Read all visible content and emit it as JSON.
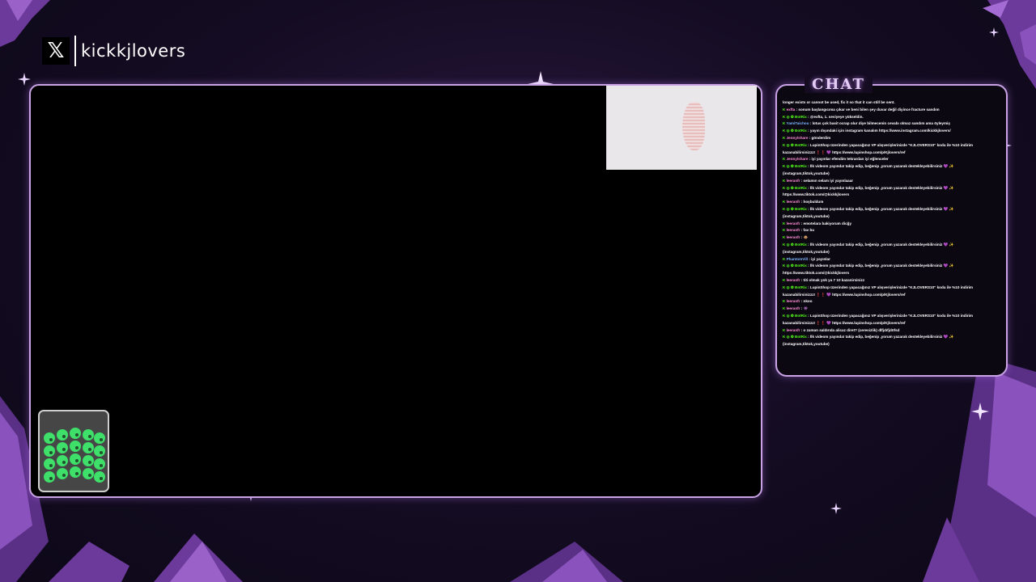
{
  "brand": {
    "logo_icon": "x-logo-icon",
    "channel": "kickkjlovers"
  },
  "chat": {
    "title": "CHAT",
    "messages": [
      {
        "badges": "",
        "user": "",
        "user_color": "",
        "text": "longer exists or cannot be used, fix it so that it can still be sent."
      },
      {
        "badges": "K",
        "user": "exfta",
        "user_color": "pink",
        "text": ": sonum başlangıcıma çıkar ve beni bilen şey duvar değil diyince fracture sandım"
      },
      {
        "badges": "K ◎ ❂",
        "user": "BotRix",
        "user_color": "green",
        "text": ": @exfta, 1. seviyeye yükseldin."
      },
      {
        "badges": "K",
        "user": "YamiTaichou",
        "user_color": "blue",
        "text": ": lotus çok basit ocrap olur diye bilmecenin cevabı olmaz sandım ama öyleymiş"
      },
      {
        "badges": "K ◎ ❂",
        "user": "BotRix",
        "user_color": "green",
        "text": ": yayın dışındaki için instagram kanalım https://www.instagram.com/kickkjlovers/"
      },
      {
        "badges": "K",
        "user": "Jenny/share",
        "user_color": "pink",
        "text": ": gönderdim"
      },
      {
        "badges": "K ◎ ❂",
        "user": "BotRix",
        "user_color": "green",
        "text": ": LupinShop üzerinden yapacağınız VP alışverişlerinizde \"KJLOVERS10\" kodu ile %10 indirim kazanabilirsinizzz! ❗❗ 💜 https://www.lupinshop.com/p/Kjlovers/ref"
      },
      {
        "badges": "K",
        "user": "Jenny/share",
        "user_color": "pink",
        "text": ": iyi yayınlar efendim tekrardan iyi eğlenceler"
      },
      {
        "badges": "K ◎ ❂",
        "user": "BotRix",
        "user_color": "green",
        "text": ": İlk videom yayında! takip edip, beğenip ,yorum yazarak destekleyebilirsiniz 💜 ✨ (instagram,tiktok,youtube)"
      },
      {
        "badges": "K",
        "user": "leeranfr",
        "user_color": "pink",
        "text": ": selamın selam iyi yayınlaaar"
      },
      {
        "badges": "K ◎ ❂",
        "user": "BotRix",
        "user_color": "green",
        "text": ": İlk videom yayında! takip edip, beğenip ,yorum yazarak destekleyebilirsiniz 💜 ✨ https://www.tiktok.com/@kickkjlovers"
      },
      {
        "badges": "K",
        "user": "leeranfr",
        "user_color": "pink",
        "text": ": hoşbuldum"
      },
      {
        "badges": "K ◎ ❂",
        "user": "BotRix",
        "user_color": "green",
        "text": ": İlk videom yayında! takip edip, beğenip ,yorum yazarak destekleyebilirsiniz 💜 ✨ (instagram,tiktok,youtube)"
      },
      {
        "badges": "K",
        "user": "leeranfr",
        "user_color": "pink",
        "text": ": emotelara bakiyorum dicğy"
      },
      {
        "badges": "K",
        "user": "leeranfr",
        "user_color": "pink",
        "text": ": fav bu"
      },
      {
        "badges": "K",
        "user": "leeranfr",
        "user_color": "pink",
        "text": ": 🐵"
      },
      {
        "badges": "K ◎ ❂",
        "user": "BotRix",
        "user_color": "green",
        "text": ": İlk videom yayında! takip edip, beğenip ,yorum yazarak destekleyebilirsiniz 💜 ✨ (instagram,tiktok,youtube)"
      },
      {
        "badges": "K",
        "user": "PhantomVill",
        "user_color": "blue",
        "text": ": iyi yayınlar"
      },
      {
        "badges": "K ◎ ❂",
        "user": "BotRix",
        "user_color": "green",
        "text": ": İlk videom yayında! takip edip, beğenip ,yorum yazarak destekleyebilirsiniz 💜 ✨ https://www.tiktok.com/@kickkjlovers"
      },
      {
        "badges": "K",
        "user": "leeranfr",
        "user_color": "pink",
        "text": ": titi olmak yok ya 7 10 kazanirsinizz"
      },
      {
        "badges": "K ◎ ❂",
        "user": "BotRix",
        "user_color": "green",
        "text": ": LupinShop üzerinden yapacağınız VP alışverişlerinizde \"KJLOVERS10\" kodu ile %10 indirim kazanabilirsinizzz! ❗❗ 💜 https://www.lupinshop.com/p/Kjlovers/ref"
      },
      {
        "badges": "K",
        "user": "leeranfr",
        "user_color": "pink",
        "text": ": nkoo"
      },
      {
        "badges": "K",
        "user": "leeranfr",
        "user_color": "pink",
        "text": ": 👾"
      },
      {
        "badges": "K ◎ ❂",
        "user": "BotRix",
        "user_color": "green",
        "text": ": LupinShop üzerinden yapacağınız VP alışverişlerinizde \"KJLOVERS10\" kodu ile %10 indirim kazanabilirsinizzz! ❗❗ 💜 https://www.lupinshop.com/p/Kjlovers/ref"
      },
      {
        "badges": "K",
        "user": "leeranfr",
        "user_color": "pink",
        "text": ": o zaman saldırıda alicaz diret? (ceresizlik) dlfjdıfjdöfsd"
      },
      {
        "badges": "K ◎ ❂",
        "user": "BotRix",
        "user_color": "green",
        "text": ": İlk videom yayında! takip edip, beğenip ,yorum yazarak destekleyebilirsiniz 💜 ✨ (instagram,tiktok,youtube)"
      }
    ]
  },
  "colors": {
    "frame_border": "#c9a3e6",
    "kick_green": "#53fc18",
    "background": "#140c22"
  },
  "icons": {
    "tip_jar": "tip-jar-icon",
    "sparkle": "sparkle-icon",
    "crystal": "crystal-decoration"
  }
}
